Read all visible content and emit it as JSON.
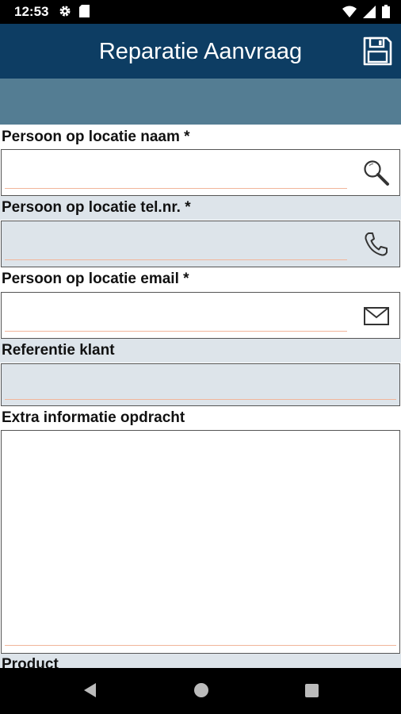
{
  "status_bar": {
    "time": "12:53",
    "left_icons": [
      "settings-gear-icon",
      "sd-card-icon"
    ],
    "right_icons": [
      "wifi-icon",
      "signal-icon",
      "battery-icon"
    ]
  },
  "app_bar": {
    "title": "Reparatie Aanvraag",
    "save_icon": "floppy-disk-icon",
    "background_color": "#0d3d63"
  },
  "subheader": {
    "background_color": "#547d93"
  },
  "form": {
    "fields": [
      {
        "label": "Persoon op locatie naam *",
        "value": "",
        "icon": "search-icon"
      },
      {
        "label": "Persoon op locatie tel.nr. *",
        "value": "",
        "icon": "phone-icon"
      },
      {
        "label": "Persoon op locatie email *",
        "value": "",
        "icon": "envelope-icon"
      },
      {
        "label": "Referentie klant",
        "value": ""
      },
      {
        "label": "Extra informatie opdracht",
        "value": ""
      },
      {
        "label": "Product"
      }
    ],
    "underline_color": "#f1b59a",
    "alt_row_color": "#dde4ea"
  },
  "nav_bar": {
    "buttons": [
      "back-icon",
      "home-icon",
      "recents-icon"
    ]
  }
}
